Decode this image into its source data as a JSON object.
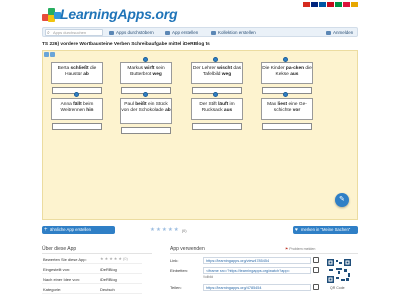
{
  "header": {
    "logo_text": "LearningApps.org",
    "flags": [
      "#d52b1e",
      "#00247d",
      "#0055a4",
      "#c60b1e",
      "#009246",
      "#dc143c",
      "#e7a700"
    ]
  },
  "nav": {
    "search_placeholder": "Apps durchsuchen",
    "items": [
      "Apps durchstöbern",
      "App erstellen",
      "Kollektion erstellen",
      "Anmelden"
    ]
  },
  "title": "TS 226) vordere Wortbausteine Verben Schreibaufgabe mittel iDeRBlog ts",
  "cards": [
    {
      "pre": "Berta ",
      "bold": "schließt",
      "post": " die Haustür ",
      "bold2": "ab"
    },
    {
      "pre": "Markus ",
      "bold": "wirft",
      "post": " sein Butterbrot ",
      "bold2": "weg"
    },
    {
      "pre": "Der Lehrer ",
      "bold": "wischt",
      "post": " das Tafelbild ",
      "bold2": "weg"
    },
    {
      "pre": "Die Kinder ",
      "bold": "pa-cken",
      "post": " die Kekse ",
      "bold2": "aus"
    },
    {
      "pre": "Anna ",
      "bold": "fällt",
      "post": " beim Weitrennen ",
      "bold2": "hin"
    },
    {
      "pre": "Paul ",
      "bold": "beißt",
      "post": " ein Stück von der Schokolade ",
      "bold2": "ab"
    },
    {
      "pre": "Der Stift ",
      "bold": "läuft",
      "post": " im Rucksack ",
      "bold2": "aus"
    },
    {
      "pre": "Max ",
      "bold": "liest",
      "post": " eine Ge-schichte ",
      "bold2": "vor"
    }
  ],
  "actions": {
    "similar_label": "ähnliche App erstellen",
    "rating_count": "(0)",
    "save_label": "merken in \"Meine Sachen\""
  },
  "about": {
    "title": "Über diese App",
    "rows": [
      {
        "label": "Bewerten Sie diese App:",
        "value": "(0)"
      },
      {
        "label": "Eingestellt von:",
        "value": "iDeRBlog"
      },
      {
        "label": "Nach einer Idee von:",
        "value": "iDeRBlog"
      },
      {
        "label": "Kategorie:",
        "value": "Deutsch"
      }
    ]
  },
  "use": {
    "title": "App verwenden",
    "report_label": "Problem melden",
    "rows": [
      {
        "label": "Link:",
        "value": "https://learningapps.org/view4785454"
      },
      {
        "label": "Einbetten:",
        "value": "<iframe src=\"https://learningapps.org/watch?app="
      },
      {
        "label": "Teilen:",
        "value": "https://learningapps.org/4785454"
      }
    ],
    "embed_small": "Vollbild",
    "qr_label": "QR Code"
  },
  "colors": {
    "accent": "#2f7fc6",
    "app_background": "#fdf3cf",
    "logo": "#1f74b8"
  }
}
